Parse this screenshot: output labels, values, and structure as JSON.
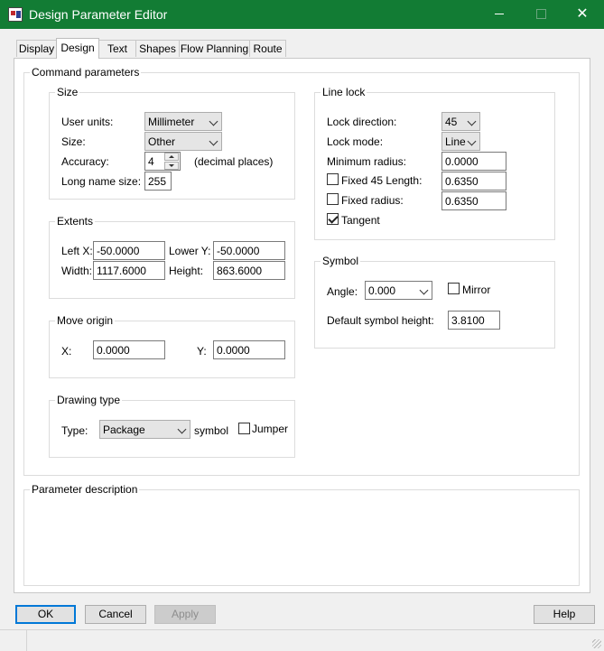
{
  "window": {
    "title": "Design Parameter Editor"
  },
  "tabs": [
    {
      "label": "Display"
    },
    {
      "label": "Design"
    },
    {
      "label": "Text"
    },
    {
      "label": "Shapes"
    },
    {
      "label": "Flow Planning"
    },
    {
      "label": "Route"
    }
  ],
  "active_tab": "Design",
  "command_parameters": {
    "label": "Command parameters",
    "size": {
      "label": "Size",
      "user_units_label": "User units:",
      "user_units_value": "Millimeter",
      "size_label": "Size:",
      "size_value": "Other",
      "accuracy_label": "Accuracy:",
      "accuracy_value": "4",
      "accuracy_hint": "(decimal places)",
      "long_name_label": "Long name size:",
      "long_name_value": "255"
    },
    "extents": {
      "label": "Extents",
      "left_x_label": "Left X:",
      "left_x_value": "-50.0000",
      "lower_y_label": "Lower Y:",
      "lower_y_value": "-50.0000",
      "width_label": "Width:",
      "width_value": "1117.6000",
      "height_label": "Height:",
      "height_value": "863.6000"
    },
    "move_origin": {
      "label": "Move origin",
      "x_label": "X:",
      "x_value": "0.0000",
      "y_label": "Y:",
      "y_value": "0.0000"
    },
    "drawing_type": {
      "label": "Drawing type",
      "type_label": "Type:",
      "type_value": "Package",
      "symbol_label": "symbol",
      "jumper_label": "Jumper",
      "jumper_checked": false
    },
    "line_lock": {
      "label": "Line lock",
      "direction_label": "Lock direction:",
      "direction_value": "45",
      "mode_label": "Lock mode:",
      "mode_value": "Line",
      "min_radius_label": "Minimum radius:",
      "min_radius_value": "0.0000",
      "fixed45_label": "Fixed 45 Length:",
      "fixed45_checked": false,
      "fixed45_value": "0.6350",
      "fixed_radius_label": "Fixed radius:",
      "fixed_radius_checked": false,
      "fixed_radius_value": "0.6350",
      "tangent_label": "Tangent",
      "tangent_checked": true
    },
    "symbol": {
      "label": "Symbol",
      "angle_label": "Angle:",
      "angle_value": "0.000",
      "mirror_label": "Mirror",
      "mirror_checked": false,
      "default_height_label": "Default symbol height:",
      "default_height_value": "3.8100"
    }
  },
  "parameter_description": {
    "label": "Parameter description",
    "text": ""
  },
  "buttons": {
    "ok": "OK",
    "cancel": "Cancel",
    "apply": "Apply",
    "help": "Help"
  },
  "colors": {
    "titlebar": "#127c34",
    "accent": "#0078d7"
  }
}
